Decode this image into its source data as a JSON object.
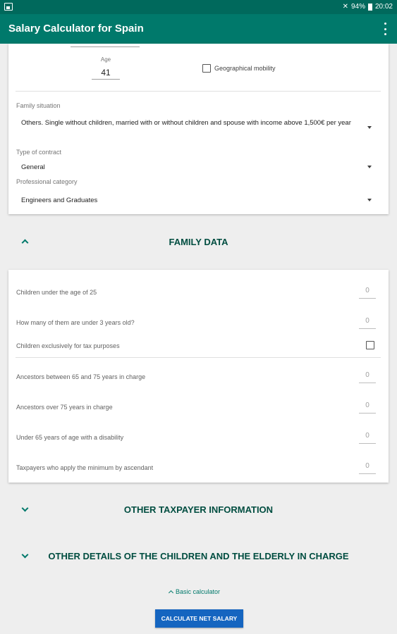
{
  "status_bar": {
    "battery": "94%",
    "time": "20:02"
  },
  "app_bar": {
    "title": "Salary Calculator for Spain"
  },
  "personal": {
    "age_label": "Age",
    "age_value": "41",
    "geo_mobility_label": "Geographical mobility",
    "family_situation_label": "Family situation",
    "family_situation_value": "Others. Single without children, married with or without children and spouse with income above 1,500€ per year",
    "contract_label": "Type of contract",
    "contract_value": "General",
    "category_label": "Professional category",
    "category_value": "Engineers and Graduates"
  },
  "family_section": {
    "title": "FAMILY DATA"
  },
  "family": {
    "children_under_25_label": "Children under the age of 25",
    "children_under_25_value": "0",
    "under_3_label": "How many of them are under 3 years old?",
    "under_3_value": "0",
    "tax_children_label": "Children exclusively for tax purposes",
    "ancestors_65_75_label": "Ancestors between 65 and 75 years in charge",
    "ancestors_65_75_value": "0",
    "ancestors_75_label": "Ancestors over 75 years in charge",
    "ancestors_75_value": "0",
    "disability_label": "Under 65 years of age with a disability",
    "disability_value": "0",
    "taxpayers_label": "Taxpayers who apply the minimum by ascendant",
    "taxpayers_value": "0"
  },
  "other_taxpayer_section": {
    "title": "OTHER TAXPAYER INFORMATION"
  },
  "other_details_section": {
    "title": "OTHER DETAILS OF THE CHILDREN AND THE ELDERLY IN CHARGE"
  },
  "footer": {
    "basic_calculator_label": "Basic calculator",
    "calculate_button_label": "CALCULATE NET SALARY"
  },
  "colors": {
    "primary": "#00796b",
    "primary_dark": "#00695c",
    "button": "#1565c0"
  }
}
